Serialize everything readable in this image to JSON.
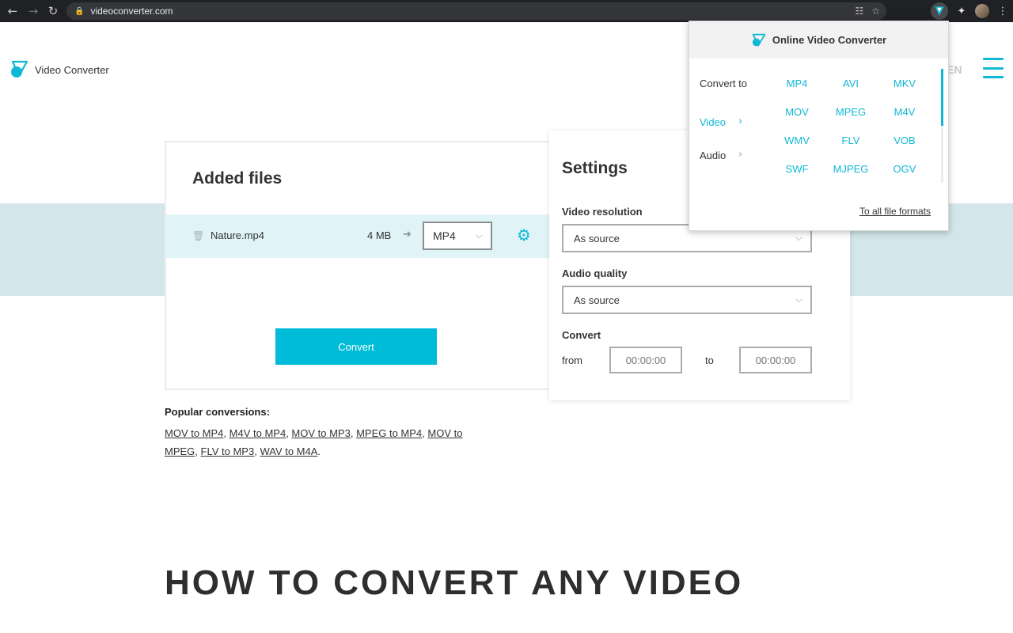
{
  "browser": {
    "url": "videoconverter.com",
    "back_icon": "←",
    "forward_icon": "→",
    "reload_icon": "↻"
  },
  "header": {
    "logo_text": "Video Converter",
    "language": "EN"
  },
  "files_card": {
    "title": "Added files",
    "files": [
      {
        "name": "Nature.mp4",
        "size": "4 MB",
        "target_format": "MP4"
      }
    ],
    "convert_label": "Convert"
  },
  "settings": {
    "title": "Settings",
    "video_resolution_label": "Video resolution",
    "video_resolution_value": "As source",
    "audio_quality_label": "Audio quality",
    "audio_quality_value": "As source",
    "convert_label": "Convert",
    "from_label": "from",
    "to_label": "to",
    "from_placeholder": "00:00:00",
    "to_placeholder": "00:00:00"
  },
  "popular": {
    "title": "Popular conversions:",
    "links": [
      "MOV to MP4",
      "M4V to MP4",
      "MOV to MP3",
      "MPEG to MP4",
      "MOV to MPEG",
      "FLV to MP3",
      "WAV to M4A"
    ]
  },
  "how_title": "HOW TO CONVERT ANY VIDEO",
  "popup": {
    "title": "Online Video Converter",
    "convert_to_label": "Convert to",
    "categories": [
      {
        "label": "Video",
        "active": true
      },
      {
        "label": "Audio",
        "active": false
      }
    ],
    "formats": [
      "MP4",
      "AVI",
      "MKV",
      "MOV",
      "MPEG",
      "M4V",
      "WMV",
      "FLV",
      "VOB",
      "SWF",
      "MJPEG",
      "OGV"
    ],
    "all_formats_link": "To all file formats"
  },
  "colors": {
    "accent": "#10b8d5",
    "button": "#00bcd8",
    "band": "#d3e6ea",
    "file_row": "#e0f4f8"
  }
}
